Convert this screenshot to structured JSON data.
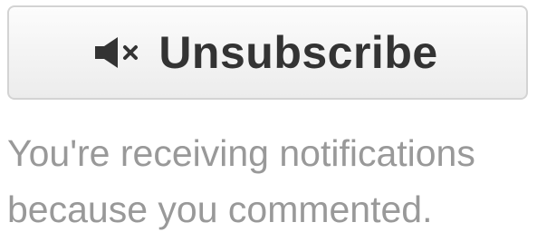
{
  "button": {
    "label": "Unsubscribe",
    "icon": "mute-speaker-icon"
  },
  "notice": {
    "line1": "You're receiving notifications",
    "line2": "because you commented."
  },
  "colors": {
    "button_text": "#333333",
    "button_border": "#d3d3d3",
    "notice_text": "#999999"
  }
}
